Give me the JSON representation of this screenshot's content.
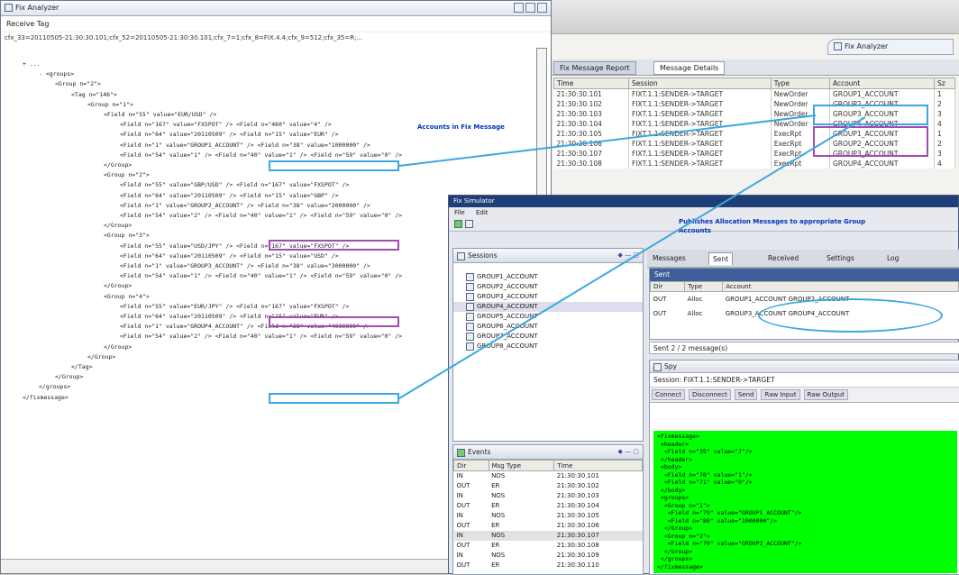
{
  "xml_window": {
    "title": "Fix Analyzer",
    "header": "Receive Tag",
    "first_line": "cfx_33=20110505-21:30:30.101;cfx_52=20110505-21:30:30.101;cfx_7=1;cfx_8=FIX.4.4;cfx_9=512;cfx_35=R;...",
    "tree_lines": [
      {
        "indent": 0,
        "text": "+ ..."
      },
      {
        "indent": 2,
        "text": "- <groups>"
      },
      {
        "indent": 4,
        "text": "<Group n=\"2\">"
      },
      {
        "indent": 6,
        "text": "<Tag n=\"146\">"
      },
      {
        "indent": 8,
        "text": "<Group n=\"1\">"
      },
      {
        "indent": 10,
        "text": "<Field n=\"55\" value=\"EUR/USD\" />"
      },
      {
        "indent": 12,
        "text": "<Field n=\"167\" value=\"FXSPOT\" /> <Field n=\"460\" value=\"4\" />"
      },
      {
        "indent": 12,
        "text": "<Field n=\"64\" value=\"20110509\" /> <Field n=\"15\" value=\"EUR\" />"
      },
      {
        "indent": 12,
        "text": "<Field n=\"1\" value=\"GROUP1_ACCOUNT\" /> <Field n=\"38\" value=\"1000000\" />"
      },
      {
        "indent": 12,
        "text": "<Field n=\"54\" value=\"1\" /> <Field n=\"40\" value=\"1\" /> <Field n=\"59\" value=\"0\" />"
      },
      {
        "indent": 10,
        "text": "</Group>"
      },
      {
        "indent": 10,
        "text": "<Group n=\"2\">"
      },
      {
        "indent": 12,
        "text": "<Field n=\"55\" value=\"GBP/USD\" /> <Field n=\"167\" value=\"FXSPOT\" />"
      },
      {
        "indent": 12,
        "text": "<Field n=\"64\" value=\"20110509\" /> <Field n=\"15\" value=\"GBP\" />"
      },
      {
        "indent": 12,
        "text": "<Field n=\"1\" value=\"GROUP2_ACCOUNT\" /> <Field n=\"38\" value=\"2000000\" />"
      },
      {
        "indent": 12,
        "text": "<Field n=\"54\" value=\"2\" /> <Field n=\"40\" value=\"1\" /> <Field n=\"59\" value=\"0\" />"
      },
      {
        "indent": 10,
        "text": "</Group>"
      },
      {
        "indent": 10,
        "text": "<Group n=\"3\">"
      },
      {
        "indent": 12,
        "text": "<Field n=\"55\" value=\"USD/JPY\" /> <Field n=\"167\" value=\"FXSPOT\" />"
      },
      {
        "indent": 12,
        "text": "<Field n=\"64\" value=\"20110509\" /> <Field n=\"15\" value=\"USD\" />"
      },
      {
        "indent": 12,
        "text": "<Field n=\"1\" value=\"GROUP3_ACCOUNT\" /> <Field n=\"38\" value=\"3000000\" />"
      },
      {
        "indent": 12,
        "text": "<Field n=\"54\" value=\"1\" /> <Field n=\"40\" value=\"1\" /> <Field n=\"59\" value=\"0\" />"
      },
      {
        "indent": 10,
        "text": "</Group>"
      },
      {
        "indent": 10,
        "text": "<Group n=\"4\">"
      },
      {
        "indent": 12,
        "text": "<Field n=\"55\" value=\"EUR/JPY\" /> <Field n=\"167\" value=\"FXSPOT\" />"
      },
      {
        "indent": 12,
        "text": "<Field n=\"64\" value=\"20110509\" /> <Field n=\"15\" value=\"EUR\" />"
      },
      {
        "indent": 12,
        "text": "<Field n=\"1\" value=\"GROUP4_ACCOUNT\" /> <Field n=\"38\" value=\"4000000\" />"
      },
      {
        "indent": 12,
        "text": "<Field n=\"54\" value=\"2\" /> <Field n=\"40\" value=\"1\" /> <Field n=\"59\" value=\"0\" />"
      },
      {
        "indent": 10,
        "text": "</Group>"
      },
      {
        "indent": 8,
        "text": "</Group>"
      },
      {
        "indent": 6,
        "text": "</Tag>"
      },
      {
        "indent": 4,
        "text": "</Group>"
      },
      {
        "indent": 2,
        "text": "</groups>"
      },
      {
        "indent": 0,
        "text": "</fixmessage>"
      }
    ],
    "annotation": "Accounts in Fix Message"
  },
  "bg_window": {
    "perspective": "Fix Analyzer",
    "tab1": "Fix Message Report",
    "tab2": "Message Details",
    "columns": [
      "Time",
      "Session",
      "Type",
      "Account",
      "Sz"
    ],
    "rows": [
      [
        "21:30:30.101",
        "FIXT.1.1:SENDER->TARGET",
        "NewOrder",
        "GROUP1_ACCOUNT",
        "1"
      ],
      [
        "21:30:30.102",
        "FIXT.1.1:SENDER->TARGET",
        "NewOrder",
        "GROUP2_ACCOUNT",
        "2"
      ],
      [
        "21:30:30.103",
        "FIXT.1.1:SENDER->TARGET",
        "NewOrder",
        "GROUP3_ACCOUNT",
        "3"
      ],
      [
        "21:30:30.104",
        "FIXT.1.1:SENDER->TARGET",
        "NewOrder",
        "GROUP4_ACCOUNT",
        "4"
      ],
      [
        "21:30:30.105",
        "FIXT.1.1:SENDER->TARGET",
        "ExecRpt",
        "GROUP1_ACCOUNT",
        "1"
      ],
      [
        "21:30:30.106",
        "FIXT.1.1:SENDER->TARGET",
        "ExecRpt",
        "GROUP2_ACCOUNT",
        "2"
      ],
      [
        "21:30:30.107",
        "FIXT.1.1:SENDER->TARGET",
        "ExecRpt",
        "GROUP3_ACCOUNT",
        "3"
      ],
      [
        "21:30:30.108",
        "FIXT.1.1:SENDER->TARGET",
        "ExecRpt",
        "GROUP4_ACCOUNT",
        "4"
      ]
    ]
  },
  "front_window": {
    "title": "Fix Simulator",
    "menu": [
      "File",
      "Edit"
    ],
    "note": "Publishes Allocation Messages to appropriate Group Accounts",
    "sessions_panel": {
      "title": "Sessions",
      "items": [
        "GROUP1_ACCOUNT",
        "GROUP2_ACCOUNT",
        "GROUP3_ACCOUNT",
        "GROUP4_ACCOUNT",
        "GROUP5_ACCOUNT",
        "GROUP6_ACCOUNT",
        "GROUP7_ACCOUNT",
        "GROUP8_ACCOUNT"
      ]
    },
    "events_panel": {
      "title": "Events",
      "columns": [
        "Dir",
        "Msg Type",
        "Time"
      ],
      "rows": [
        [
          "IN",
          "NOS",
          "21:30:30.101"
        ],
        [
          "OUT",
          "ER",
          "21:30:30.102"
        ],
        [
          "IN",
          "NOS",
          "21:30:30.103"
        ],
        [
          "OUT",
          "ER",
          "21:30:30.104"
        ],
        [
          "IN",
          "NOS",
          "21:30:30.105"
        ],
        [
          "OUT",
          "ER",
          "21:30:30.106"
        ],
        [
          "IN",
          "NOS",
          "21:30:30.107"
        ],
        [
          "OUT",
          "ER",
          "21:30:30.108"
        ],
        [
          "IN",
          "NOS",
          "21:30:30.109"
        ],
        [
          "OUT",
          "ER",
          "21:30:30.110"
        ]
      ]
    },
    "right_tabs": [
      "Messages",
      "Sent",
      "Received",
      "Settings",
      "Log"
    ],
    "sent_panel": {
      "title": "Sent",
      "columns": [
        "Dir",
        "Type",
        "Account"
      ],
      "rows": [
        [
          "OUT",
          "Alloc",
          "GROUP1_ACCOUNT GROUP2_ACCOUNT"
        ],
        [
          "OUT",
          "Alloc",
          "GROUP3_ACCOUNT GROUP4_ACCOUNT"
        ]
      ]
    },
    "summary": "Sent 2 / 2 message(s)",
    "spy_panel": {
      "title": "Spy",
      "line": "Session: FIXT.1.1:SENDER->TARGET",
      "subtabs": [
        "Connect",
        "Disconnect",
        "Send",
        "Raw Input",
        "Raw Output"
      ],
      "xml": "<fixmessage>\n <header>\n  <Field n=\"35\" value=\"J\"/>\n </header>\n <body>\n  <Field n=\"70\" value=\"1\"/>\n  <Field n=\"71\" value=\"0\"/>\n </body>\n <groups>\n  <Group n=\"1\">\n   <Field n=\"79\" value=\"GROUP1_ACCOUNT\"/>\n   <Field n=\"80\" value=\"1000000\"/>\n  </Group>\n  <Group n=\"2\">\n   <Field n=\"79\" value=\"GROUP2_ACCOUNT\"/>\n  </Group>\n </groups>\n</fixmessage>"
    }
  },
  "colors": {
    "highlight_blue": "#3aa8df",
    "highlight_purple": "#a54ab5",
    "spy_green": "#00ff00"
  }
}
